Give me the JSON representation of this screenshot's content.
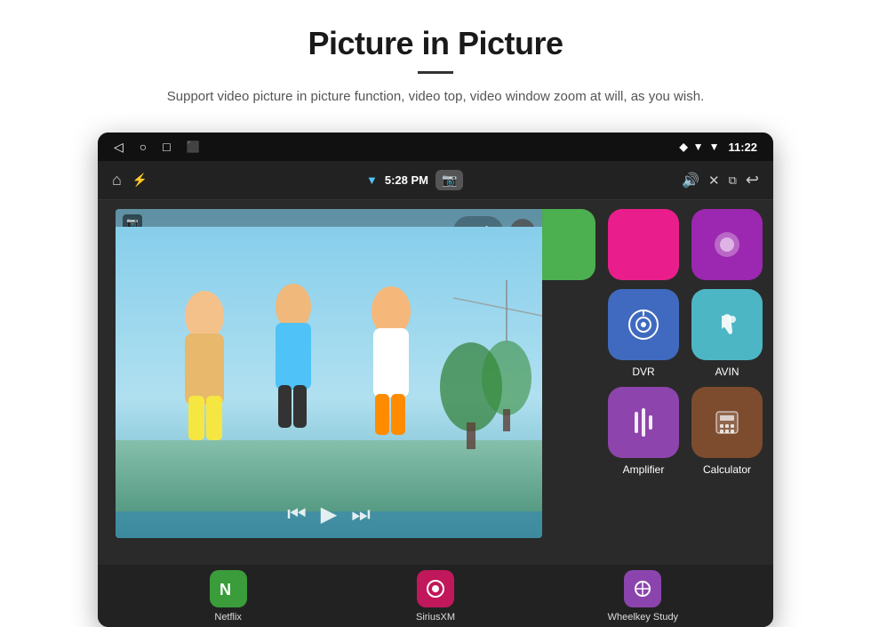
{
  "page": {
    "title": "Picture in Picture",
    "subtitle": "Support video picture in picture function, video top, video window zoom at will, as you wish.",
    "divider": true
  },
  "statusbar": {
    "time": "11:22",
    "icons": [
      "back",
      "home",
      "recent",
      "screenshot",
      "location",
      "wifi"
    ]
  },
  "toolbar": {
    "time": "5:28 PM",
    "icons": [
      "home",
      "usb",
      "wifi",
      "camera",
      "volume",
      "close",
      "pip",
      "back"
    ]
  },
  "apps": {
    "top_row": [
      {
        "id": "app-green",
        "label": "",
        "color": "green"
      },
      {
        "id": "app-pink",
        "label": "",
        "color": "pink"
      },
      {
        "id": "app-purple-light",
        "label": "",
        "color": "purple-light"
      }
    ],
    "mid_row": [
      {
        "id": "dvr",
        "label": "DVR",
        "color": "blue"
      },
      {
        "id": "avin",
        "label": "AVIN",
        "color": "teal"
      }
    ],
    "bot_row": [
      {
        "id": "amplifier",
        "label": "Amplifier",
        "color": "purple"
      },
      {
        "id": "calculator",
        "label": "Calculator",
        "color": "brown"
      }
    ]
  },
  "bottom_apps": [
    {
      "id": "netflix",
      "label": "Netflix",
      "color": "#3a9c3a"
    },
    {
      "id": "siriusxm",
      "label": "SiriusXM",
      "color": "#c0185a"
    },
    {
      "id": "wheelkey",
      "label": "Wheelkey Study",
      "color": "#8b44ad"
    }
  ]
}
